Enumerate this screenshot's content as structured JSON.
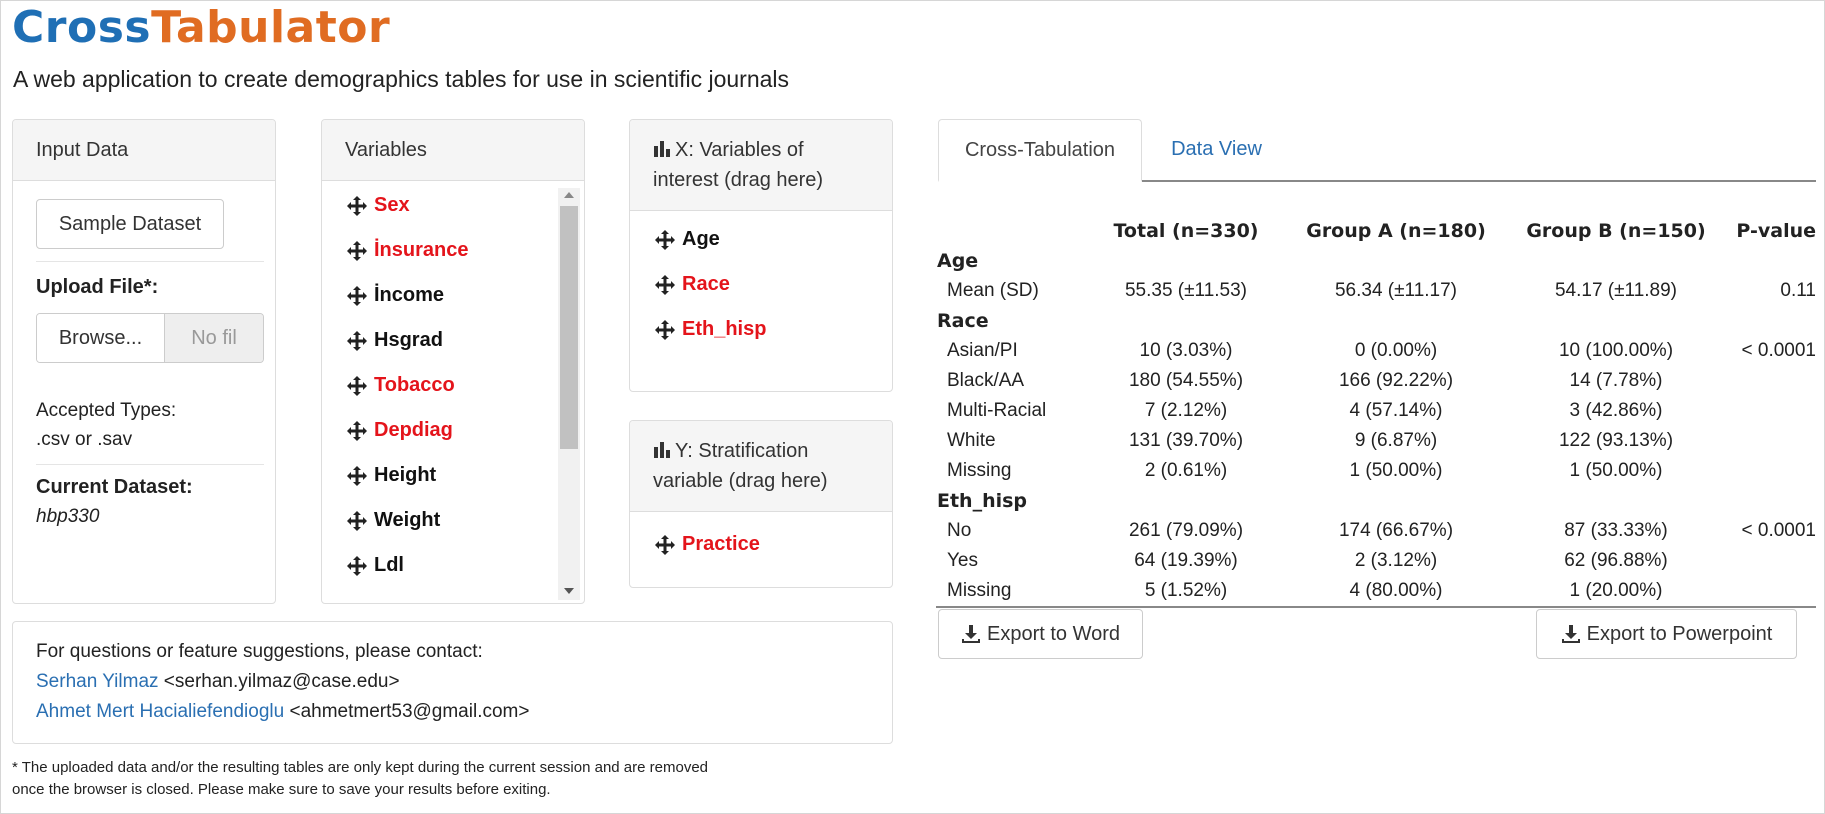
{
  "app": {
    "title_part1": "Cross",
    "title_part2": "Tabulator",
    "subtitle": "A web application to create demographics tables for use in scientific journals"
  },
  "input_panel": {
    "header": "Input Data",
    "sample_button": "Sample Dataset",
    "upload_label": "Upload File*:",
    "browse_button": "Browse...",
    "file_placeholder": "No fil",
    "accepted_line1": "Accepted Types:",
    "accepted_line2": ".csv or .sav",
    "current_label": "Current Dataset:",
    "current_value": "hbp330"
  },
  "variables_panel": {
    "header": "Variables",
    "items": [
      {
        "label": "Sex",
        "color": "#e4141b"
      },
      {
        "label": "İnsurance",
        "color": "#e4141b"
      },
      {
        "label": "İncome",
        "color": "#111111"
      },
      {
        "label": "Hsgrad",
        "color": "#111111"
      },
      {
        "label": "Tobacco",
        "color": "#e4141b"
      },
      {
        "label": "Depdiag",
        "color": "#e4141b"
      },
      {
        "label": "Height",
        "color": "#111111"
      },
      {
        "label": "Weight",
        "color": "#111111"
      },
      {
        "label": "Ldl",
        "color": "#111111"
      }
    ]
  },
  "x_panel": {
    "header_line1": "X: Variables of",
    "header_line2": "interest (drag here)",
    "items": [
      {
        "label": "Age",
        "color": "#111111"
      },
      {
        "label": "Race",
        "color": "#e4141b"
      },
      {
        "label": "Eth_hisp",
        "color": "#e4141b"
      }
    ]
  },
  "y_panel": {
    "header_line1": "Y: Stratification",
    "header_line2": "variable (drag here)",
    "items": [
      {
        "label": "Practice",
        "color": "#e4141b"
      }
    ]
  },
  "contact": {
    "line1": "For questions or feature suggestions, please contact:",
    "person1_name": "Serhan Yilmaz",
    "person1_email": "<serhan.yilmaz@case.edu>",
    "person2_name": "Ahmet Mert Hacialiefendioglu",
    "person2_email": "<ahmetmert53@gmail.com>"
  },
  "footnote": {
    "line1": "* The uploaded data and/or the resulting tables are only kept during the current session and are removed",
    "line2": "once the browser is closed. Please make sure to save your results before exiting."
  },
  "tabs": {
    "active": "Cross-Tabulation",
    "other": "Data View"
  },
  "table": {
    "headers": [
      "",
      "Total (n=330)",
      "Group A (n=180)",
      "Group B (n=150)",
      "P-value"
    ],
    "sections": [
      {
        "name": "Age",
        "rows": [
          {
            "label": "Mean (SD)",
            "total": "55.35 (±11.53)",
            "a": "56.34 (±11.17)",
            "b": "54.17 (±11.89)",
            "p": "0.11"
          }
        ]
      },
      {
        "name": "Race",
        "rows": [
          {
            "label": "Asian/PI",
            "total": "10 (3.03%)",
            "a": "0 (0.00%)",
            "b": "10 (100.00%)",
            "p": "< 0.0001"
          },
          {
            "label": "Black/AA",
            "total": "180 (54.55%)",
            "a": "166 (92.22%)",
            "b": "14 (7.78%)",
            "p": ""
          },
          {
            "label": "Multi-Racial",
            "total": "7 (2.12%)",
            "a": "4 (57.14%)",
            "b": "3 (42.86%)",
            "p": ""
          },
          {
            "label": "White",
            "total": "131 (39.70%)",
            "a": "9 (6.87%)",
            "b": "122 (93.13%)",
            "p": ""
          },
          {
            "label": "Missing",
            "total": "2 (0.61%)",
            "a": "1 (50.00%)",
            "b": "1 (50.00%)",
            "p": ""
          }
        ]
      },
      {
        "name": "Eth_hisp",
        "rows": [
          {
            "label": "No",
            "total": "261 (79.09%)",
            "a": "174 (66.67%)",
            "b": "87 (33.33%)",
            "p": "< 0.0001"
          },
          {
            "label": "Yes",
            "total": "64 (19.39%)",
            "a": "2 (3.12%)",
            "b": "62 (96.88%)",
            "p": ""
          },
          {
            "label": "Missing",
            "total": "5 (1.52%)",
            "a": "4 (80.00%)",
            "b": "1 (20.00%)",
            "p": ""
          }
        ]
      }
    ]
  },
  "export": {
    "word": "Export to Word",
    "ppt": "Export to Powerpoint"
  }
}
